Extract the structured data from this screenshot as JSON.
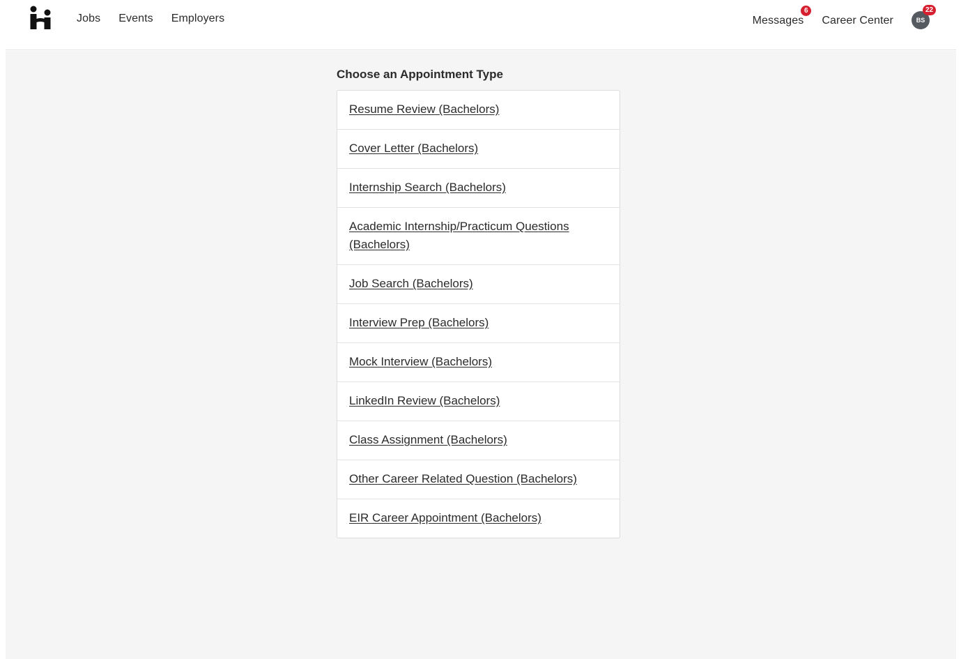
{
  "header": {
    "logo_icon": "handshake-logo-icon",
    "nav_left": [
      {
        "label": "Jobs"
      },
      {
        "label": "Events"
      },
      {
        "label": "Employers"
      }
    ],
    "messages": {
      "label": "Messages",
      "badge": "6"
    },
    "career_center": {
      "label": "Career Center"
    },
    "avatar": {
      "initials": "BS",
      "badge": "22"
    }
  },
  "main": {
    "heading": "Choose an Appointment Type",
    "appointment_types": [
      {
        "label": "Resume Review (Bachelors)"
      },
      {
        "label": "Cover Letter (Bachelors)"
      },
      {
        "label": "Internship Search (Bachelors)"
      },
      {
        "label": "Academic Internship/Practicum Questions (Bachelors)"
      },
      {
        "label": "Job Search (Bachelors)"
      },
      {
        "label": "Interview Prep (Bachelors)"
      },
      {
        "label": "Mock Interview (Bachelors)"
      },
      {
        "label": "LinkedIn Review (Bachelors)"
      },
      {
        "label": "Class Assignment (Bachelors)"
      },
      {
        "label": "Other Career Related Question (Bachelors)"
      },
      {
        "label": "EIR Career Appointment (Bachelors)"
      }
    ]
  },
  "colors": {
    "badge": "#d6202f",
    "content_background": "#f5f5f5",
    "avatar": "#555a60"
  }
}
